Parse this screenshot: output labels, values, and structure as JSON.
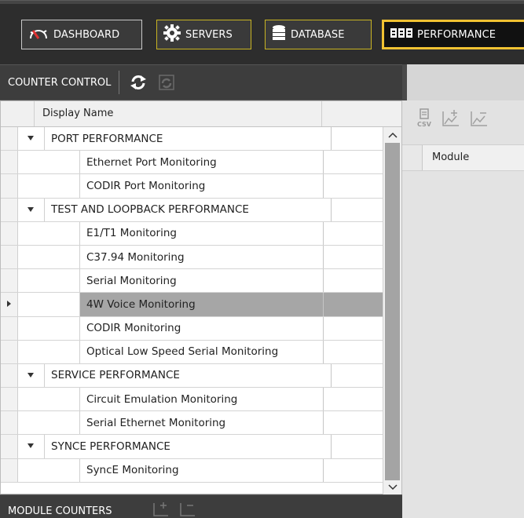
{
  "nav": {
    "dashboard": "DASHBOARD",
    "servers": "SERVERS",
    "database": "DATABASE",
    "performance": "PERFORMANCE",
    "active": "performance",
    "colors": {
      "active_border": "#f1c232",
      "servers_border": "#c9b422"
    }
  },
  "counter_control": {
    "title": "COUNTER CONTROL",
    "icons": [
      "refresh-icon",
      "refresh-disabled-icon"
    ]
  },
  "tree": {
    "columns": [
      "Display Name",
      ""
    ],
    "rows": [
      {
        "type": "group",
        "label": "PORT PERFORMANCE"
      },
      {
        "type": "leaf",
        "label": "Ethernet Port Monitoring"
      },
      {
        "type": "leaf",
        "label": "CODIR Port Monitoring"
      },
      {
        "type": "group",
        "label": "TEST AND LOOPBACK PERFORMANCE"
      },
      {
        "type": "leaf",
        "label": "E1/T1 Monitoring"
      },
      {
        "type": "leaf",
        "label": "C37.94 Monitoring"
      },
      {
        "type": "leaf",
        "label": "Serial Monitoring"
      },
      {
        "type": "leaf",
        "label": "4W Voice Monitoring",
        "selected": true
      },
      {
        "type": "leaf",
        "label": "CODIR Monitoring"
      },
      {
        "type": "leaf",
        "label": "Optical Low Speed Serial Monitoring"
      },
      {
        "type": "group",
        "label": "SERVICE PERFORMANCE"
      },
      {
        "type": "leaf",
        "label": "Circuit Emulation Monitoring"
      },
      {
        "type": "leaf",
        "label": "Serial Ethernet Monitoring"
      },
      {
        "type": "group",
        "label": "SYNCE PERFORMANCE"
      },
      {
        "type": "leaf",
        "label": "SyncE Monitoring"
      }
    ]
  },
  "module_panel": {
    "column": "Module",
    "toolbar_icons": [
      "csv-export-icon",
      "add-chart-icon",
      "remove-chart-icon"
    ]
  },
  "module_counters": {
    "title": "MODULE COUNTERS",
    "icons": [
      "add-chart-icon",
      "remove-chart-icon"
    ]
  }
}
